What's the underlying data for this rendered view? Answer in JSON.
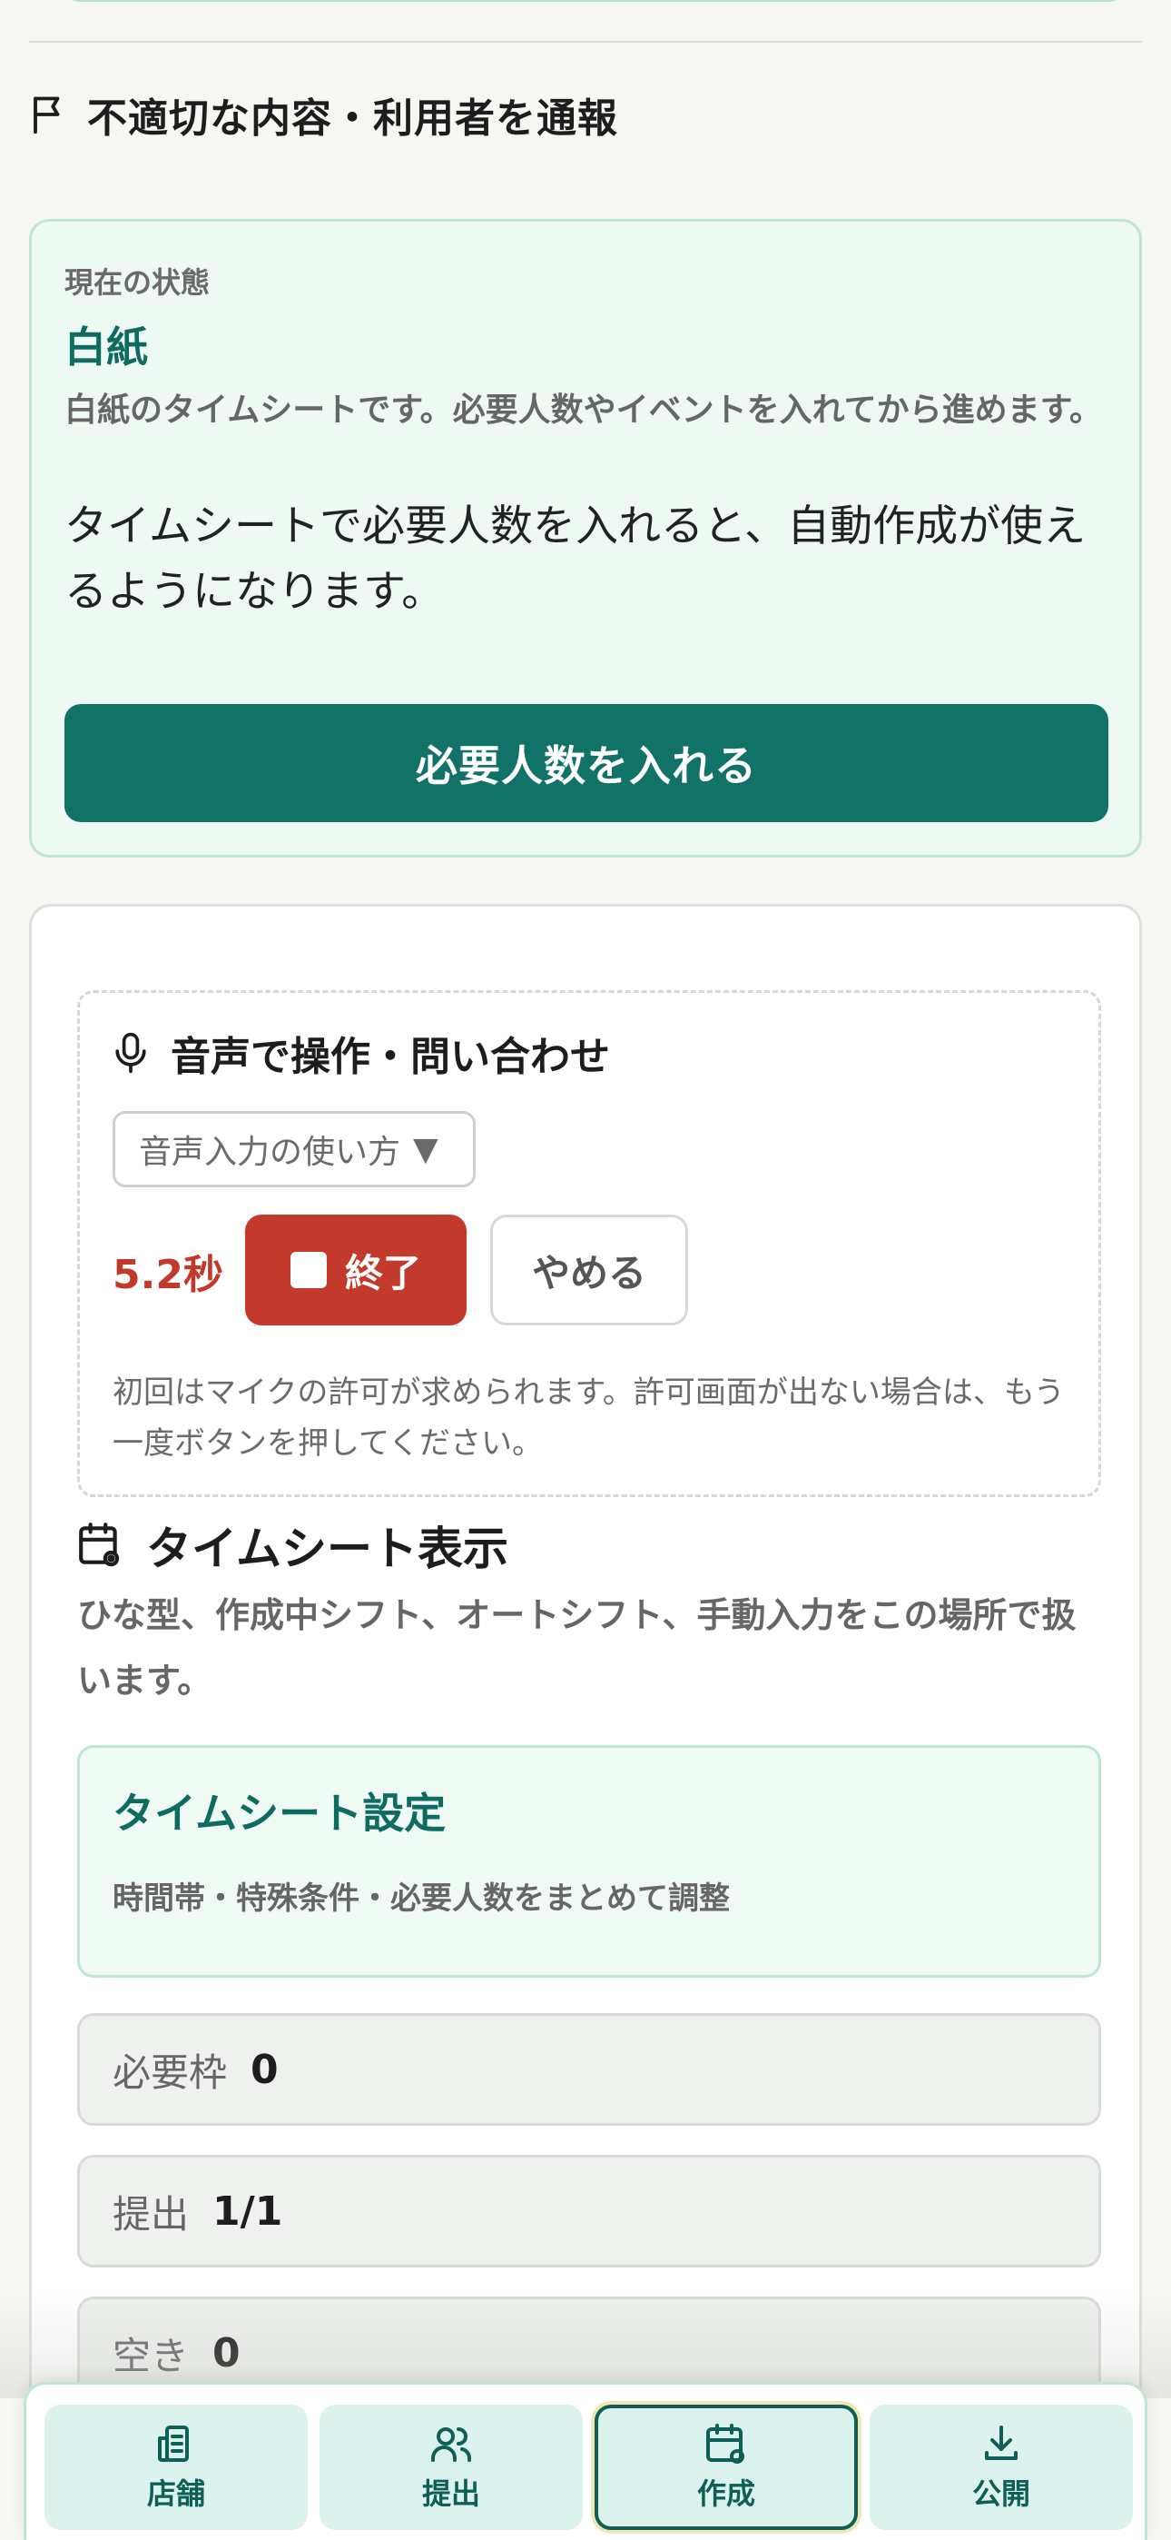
{
  "report": {
    "label": "不適切な内容・利用者を通報",
    "icon": "flag-icon"
  },
  "status": {
    "eyebrow": "現在の状態",
    "state": "白紙",
    "description": "白紙のタイムシートです。必要人数やイベントを入れてから進めます。",
    "hint": "タイムシートで必要人数を入れると、自動作成が使えるようになります。",
    "primary_button": "必要人数を入れる"
  },
  "voice": {
    "title": "音声で操作・問い合わせ",
    "icon": "microphone-icon",
    "howto_label": "音声入力の使い方",
    "timer": "5.2秒",
    "stop_label": "終了",
    "cancel_label": "やめる",
    "note": "初回はマイクの許可が求められます。許可画面が出ない場合は、もう一度ボタンを押してください。"
  },
  "timesheet": {
    "title": "タイムシート表示",
    "icon": "calendar-gear-icon",
    "description": "ひな型、作成中シフト、オートシフト、手動入力をこの場所で扱います。",
    "settings": {
      "title": "タイムシート設定",
      "subtitle": "時間帯・特殊条件・必要人数をまとめて調整"
    },
    "stats": [
      {
        "label": "必要枠",
        "value": "0"
      },
      {
        "label": "提出",
        "value": "1/1"
      },
      {
        "label": "空き",
        "value": "0"
      }
    ]
  },
  "nav": {
    "items": [
      {
        "label": "店舗",
        "icon": "store-icon",
        "active": false
      },
      {
        "label": "提出",
        "icon": "users-icon",
        "active": false
      },
      {
        "label": "作成",
        "icon": "calendar-gear-icon",
        "active": true
      },
      {
        "label": "公開",
        "icon": "download-icon",
        "active": false
      }
    ]
  },
  "colors": {
    "accent": "#117368",
    "accent_text": "#0e6b5f",
    "danger": "#c3392c",
    "mint_bg": "#eef9f3",
    "mint_border": "#bfe6d4"
  }
}
